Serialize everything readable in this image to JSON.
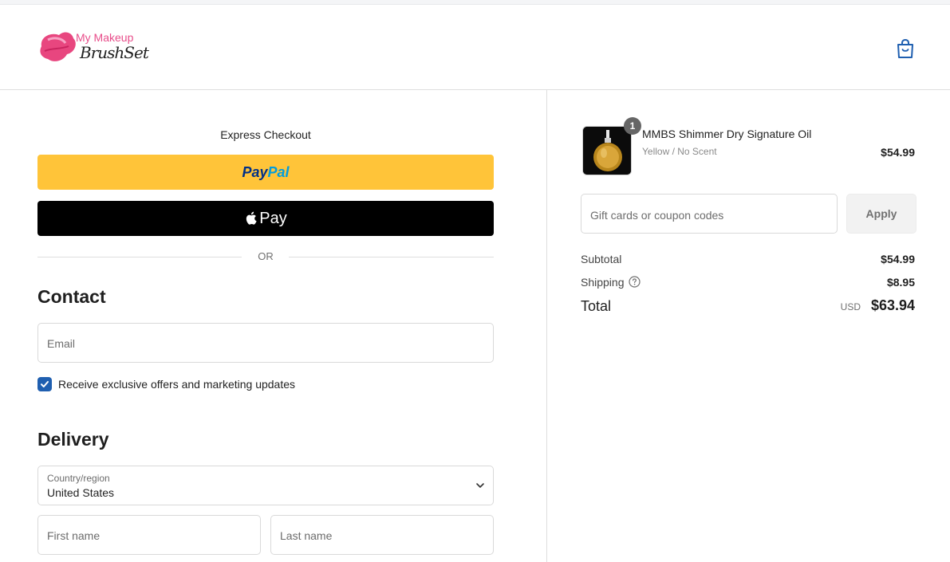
{
  "header": {
    "logo_top": "My Makeup",
    "logo_script": "BrushSet"
  },
  "express": {
    "title": "Express Checkout",
    "paypal_part1": "Pay",
    "paypal_part2": "Pal",
    "apple_pay_label": "Pay",
    "or_label": "OR"
  },
  "contact": {
    "heading": "Contact",
    "email_placeholder": "Email",
    "marketing_label": "Receive exclusive offers and marketing updates",
    "marketing_checked": true
  },
  "delivery": {
    "heading": "Delivery",
    "country_label": "Country/region",
    "country_value": "United States",
    "first_name_placeholder": "First name",
    "last_name_placeholder": "Last name"
  },
  "order": {
    "item": {
      "quantity": "1",
      "name": "MMBS Shimmer Dry Signature Oil",
      "variant": "Yellow / No Scent",
      "price": "$54.99"
    },
    "coupon_placeholder": "Gift cards or coupon codes",
    "apply_label": "Apply",
    "subtotal_label": "Subtotal",
    "subtotal_value": "$54.99",
    "shipping_label": "Shipping",
    "shipping_value": "$8.95",
    "total_label": "Total",
    "total_currency": "USD",
    "total_value": "$63.94"
  },
  "colors": {
    "paypal_yellow": "#ffc439",
    "checkbox_blue": "#1f5fb0",
    "brand_pink": "#e84d8a",
    "bag_icon": "#1f5fb0"
  }
}
